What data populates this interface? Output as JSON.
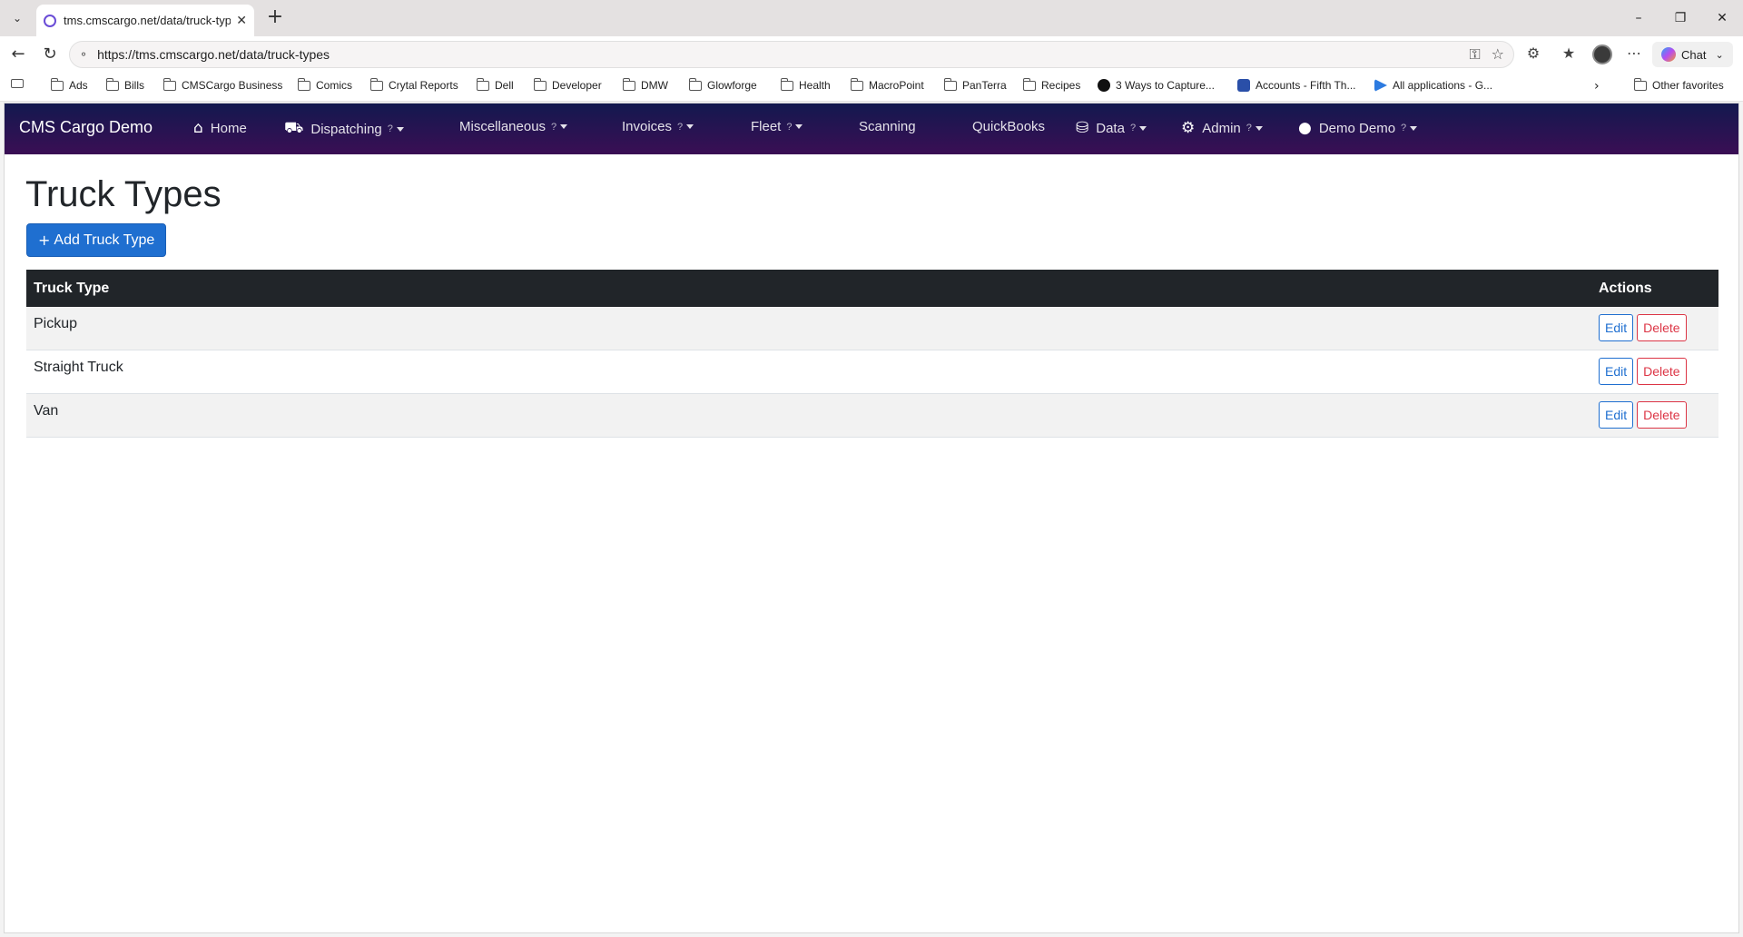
{
  "browser": {
    "tab_title": "tms.cmscargo.net/data/truck-types",
    "url": "https://tms.cmscargo.net/data/truck-types",
    "chat_label": "Chat",
    "bookmarks": [
      "Ads",
      "Bills",
      "CMSCargo Business",
      "Comics",
      "Crytal Reports",
      "Dell",
      "Developer",
      "DMW",
      "Glowforge",
      "Health",
      "MacroPoint",
      "PanTerra",
      "Recipes",
      "3 Ways to Capture...",
      "Accounts - Fifth Th...",
      "All applications - G..."
    ],
    "other_favorites": "Other favorites"
  },
  "app": {
    "brand": "CMS Cargo Demo",
    "nav": {
      "home": "Home",
      "dispatching": "Dispatching",
      "miscellaneous": "Miscellaneous",
      "invoices": "Invoices",
      "fleet": "Fleet",
      "scanning": "Scanning",
      "quickbooks": "QuickBooks",
      "data": "Data",
      "admin": "Admin",
      "user": "Demo Demo",
      "help_mark": "?"
    }
  },
  "page": {
    "title": "Truck Types",
    "add_button": "Add Truck Type",
    "table": {
      "col_type": "Truck Type",
      "col_actions": "Actions",
      "rows": [
        {
          "type": "Pickup",
          "edit": "Edit",
          "delete": "Delete"
        },
        {
          "type": "Straight Truck",
          "edit": "Edit",
          "delete": "Delete"
        },
        {
          "type": "Van",
          "edit": "Edit",
          "delete": "Delete"
        }
      ]
    }
  },
  "colors": {
    "nav_start": "#13194f",
    "nav_end": "#3a0e54",
    "primary": "#1f6fd0",
    "danger": "#dc3545",
    "table_header": "#212529"
  }
}
